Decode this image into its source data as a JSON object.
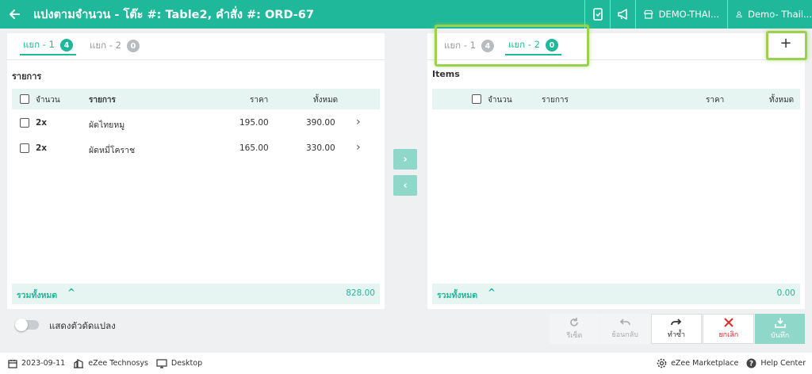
{
  "header": {
    "title": "แบ่งตามจำนวน - โต๊ะ #: Table2, คำสั่ง #: ORD-67",
    "store": "DEMO-THAI...",
    "user": "Demo- Thail..."
  },
  "left_panel": {
    "tabs": [
      {
        "label": "แยก - 1",
        "count": "4"
      },
      {
        "label": "แยก - 2",
        "count": "0"
      }
    ],
    "section_title": "รายการ",
    "columns": {
      "qty": "จำนวน",
      "item": "รายการ",
      "price": "ราคา",
      "total": "ทั้งหมด"
    },
    "rows": [
      {
        "qty": "2x",
        "item": "ผัดไทยหมู",
        "price": "195.00",
        "total": "390.00"
      },
      {
        "qty": "2x",
        "item": "ผัดหมี่โคราช",
        "price": "165.00",
        "total": "330.00"
      }
    ],
    "total_label": "รวมทั้งหมด",
    "total_amount": "828.00"
  },
  "right_panel": {
    "tabs": [
      {
        "label": "แยก - 1",
        "count": "4"
      },
      {
        "label": "แยก - 2",
        "count": "0"
      }
    ],
    "add_label": "+",
    "section_title": "Items",
    "columns": {
      "qty": "จำนวน",
      "item": "รายการ",
      "price": "ราคา",
      "total": "ทั้งหมด"
    },
    "total_label": "รวมทั้งหมด",
    "total_amount": "0.00"
  },
  "move_buttons": {
    "right": "›",
    "left": "‹"
  },
  "toggle_label": "แสดงตัวดัดแปลง",
  "actions": {
    "reset": "รีเซ็ต",
    "undo": "ย้อนกลับ",
    "redo": "ทำซ้ำ",
    "cancel": "ยกเลิก",
    "save": "บันทึก"
  },
  "statusbar": {
    "date": "2023-09-11",
    "company": "eZee Technosys",
    "device": "Desktop",
    "marketplace": "eZee Marketplace",
    "help": "Help Center"
  },
  "colors": {
    "accent": "#1fb89a",
    "highlight": "#9ad14e",
    "cancel": "#e02b2b"
  }
}
